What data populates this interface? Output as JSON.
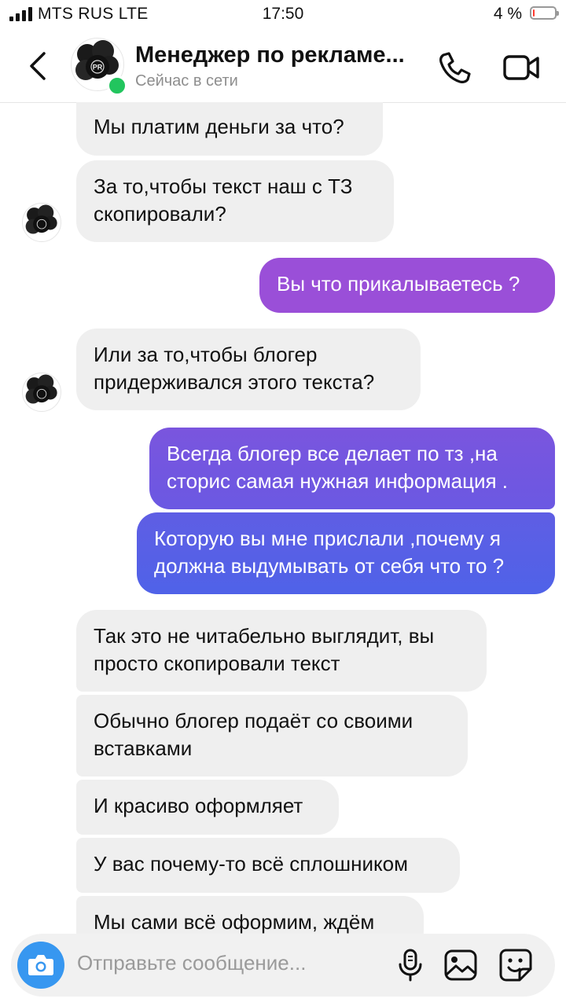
{
  "status_bar": {
    "carrier": "MTS RUS LTE",
    "time": "17:50",
    "battery": "4 %",
    "battery_level": 0.04
  },
  "header": {
    "contact_name": "Менеджер по рекламе...",
    "contact_status": "Сейчас в сети",
    "avatar_logo_text": "PR"
  },
  "messages": [
    {
      "direction": "in",
      "text": "Мы платим деньги за что?"
    },
    {
      "direction": "in",
      "text": "За то,чтобы текст наш с ТЗ скопировали?"
    },
    {
      "direction": "out",
      "text": "Вы что прикалываетесь ?"
    },
    {
      "direction": "in",
      "text": "Или за то,чтобы блогер придерживался этого текста?"
    },
    {
      "direction": "out",
      "text": "Всегда блогер все делает по тз ,на сторис самая нужная информация ."
    },
    {
      "direction": "out",
      "text": "Которую вы мне прислали ,почему я должна выдумывать от себя что то ?"
    },
    {
      "direction": "in",
      "text": "Так это не читабельно выглядит, вы просто скопировали текст"
    },
    {
      "direction": "in",
      "text": "Обычно блогер подаёт со своими вставками"
    },
    {
      "direction": "in",
      "text": "И красиво оформляет"
    },
    {
      "direction": "in",
      "text": "У вас почему-то всё сплошником"
    },
    {
      "direction": "in",
      "text": "Мы сами всё оформим, ждём"
    }
  ],
  "composer": {
    "placeholder": "Отправьте сообщение..."
  },
  "colors": {
    "incoming_bubble": "#efefef",
    "outgoing_gradient_top": "#9b4fd6",
    "outgoing_gradient_bottom": "#4f5fe6",
    "camera_button": "#3797f0",
    "online": "#22c55e",
    "battery_low": "#ff3b30"
  }
}
